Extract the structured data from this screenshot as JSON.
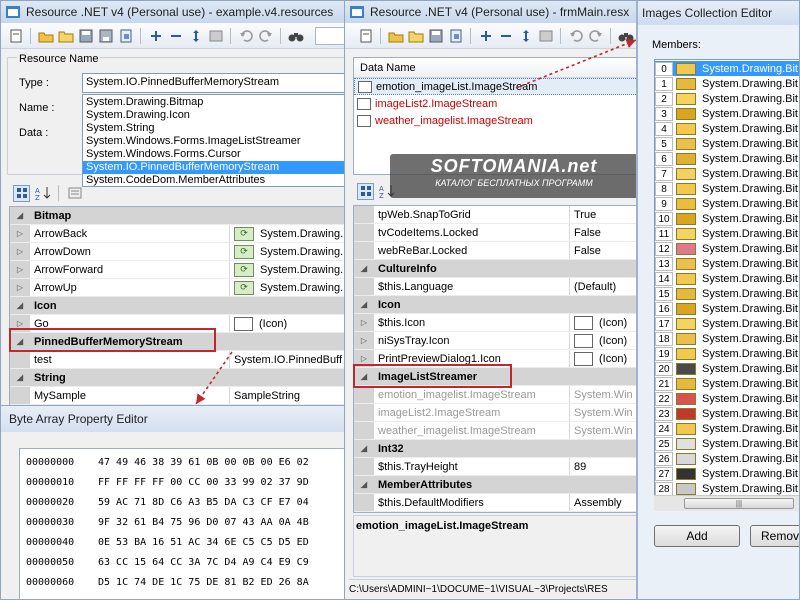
{
  "left_window": {
    "title": "Resource .NET v4 (Personal  use) - example.v4.resources",
    "resource_group_label": "Resource Name",
    "type_label": "Type :",
    "type_value": "System.IO.PinnedBufferMemoryStream",
    "name_label": "Name :",
    "data_label": "Data :",
    "type_options": [
      "System.Drawing.Bitmap",
      "System.Drawing.Icon",
      "System.String",
      "System.Windows.Forms.ImageListStreamer",
      "System.Windows.Forms.Cursor",
      "System.IO.PinnedBufferMemoryStream",
      "System.CodeDom.MemberAttributes"
    ],
    "selected_option": "System.IO.PinnedBufferMemoryStream",
    "grid": {
      "cat_bitmap": "Bitmap",
      "bitmap_rows": [
        {
          "name": "ArrowBack",
          "value": "System.Drawing."
        },
        {
          "name": "ArrowDown",
          "value": "System.Drawing."
        },
        {
          "name": "ArrowForward",
          "value": "System.Drawing."
        },
        {
          "name": "ArrowUp",
          "value": "System.Drawing."
        }
      ],
      "cat_icon": "Icon",
      "icon_row": {
        "name": "Go",
        "value": "(Icon)"
      },
      "cat_pinned": "PinnedBufferMemoryStream",
      "pinned_row": {
        "name": "test",
        "value": "System.IO.PinnedBuff"
      },
      "cat_string": "String",
      "string_row": {
        "name": "MySample",
        "value": "SampleString"
      }
    }
  },
  "byte_editor": {
    "title": "Byte Array Property Editor",
    "rows": [
      {
        "offset": "00000000",
        "bytes": "47  49  46  38  39  61  0B  00    0B  00  E6  02"
      },
      {
        "offset": "00000010",
        "bytes": "FF  FF  FF  FF  00  CC  00  33    99  02  37  9D"
      },
      {
        "offset": "00000020",
        "bytes": "59  AC  71  8D  C6  A3  B5  DA    C3  CF  E7  04"
      },
      {
        "offset": "00000030",
        "bytes": "9F  32  61  B4  75  96  D0  07    43  AA  0A  4B"
      },
      {
        "offset": "00000040",
        "bytes": "0E  53  BA  16  51  AC  34  6E    C5  C5  D5  ED"
      },
      {
        "offset": "00000050",
        "bytes": "63  CC  15  64  CC  3A  7C  D4    A9  C4  E9  C9"
      },
      {
        "offset": "00000060",
        "bytes": "D5  1C  74  DE  1C  75  DE  81    B2  ED  26  8A"
      }
    ]
  },
  "mid_window": {
    "title": "Resource .NET v4 (Personal  use) - frmMain.resx",
    "data_name_header": "Data Name",
    "data_items": [
      "emotion_imageList.ImageStream",
      "imageList2.ImageStream",
      "weather_imagelist.ImageStream"
    ],
    "watermark_title": "SOFTOMANIA.net",
    "watermark_sub": "КАТАЛОГ БЕСПЛАТНЫХ ПРОГРАММ",
    "grid": {
      "top_rows": [
        {
          "name": "tpWeb.SnapToGrid",
          "value": "True"
        },
        {
          "name": "tvCodeItems.Locked",
          "value": "False"
        },
        {
          "name": "webReBar.Locked",
          "value": "False"
        }
      ],
      "cat_culture": "CultureInfo",
      "culture_row": {
        "name": "$this.Language",
        "value": "(Default)"
      },
      "cat_icon": "Icon",
      "icon_rows": [
        {
          "name": "$this.Icon",
          "value": "(Icon)"
        },
        {
          "name": "niSysTray.Icon",
          "value": "(Icon)"
        },
        {
          "name": "PrintPreviewDialog1.Icon",
          "value": "(Icon)"
        }
      ],
      "cat_imagelist": "ImageListStreamer",
      "imagelist_rows": [
        {
          "name": "emotion_imagelist.ImageStream",
          "value": "System.Win"
        },
        {
          "name": "imageList2.ImageStream",
          "value": "System.Win"
        },
        {
          "name": "weather_imagelist.ImageStream",
          "value": "System.Win"
        }
      ],
      "cat_int32": "Int32",
      "int32_row": {
        "name": "$this.TrayHeight",
        "value": "89"
      },
      "cat_member": "MemberAttributes",
      "member_row": {
        "name": "$this.DefaultModifiers",
        "value": "Assembly"
      }
    },
    "description": "emotion_imageList.ImageStream",
    "status_path": "C:\\Users\\ADMINI~1\\DOCUME~1\\VISUAL~3\\Projects\\RES"
  },
  "images_editor": {
    "title": "Images Collection Editor",
    "members_label": "Members:",
    "item_label": "System.Drawing.Bit",
    "indices": [
      "0",
      "1",
      "2",
      "3",
      "4",
      "5",
      "6",
      "7",
      "8",
      "9",
      "10",
      "11",
      "12",
      "13",
      "14",
      "15",
      "16",
      "17",
      "18",
      "19",
      "20",
      "21",
      "22",
      "23",
      "24",
      "25",
      "26",
      "27",
      "28"
    ],
    "add_label": "Add",
    "remove_label": "Remov",
    "scroll_grip": "|||"
  },
  "colors": {
    "title_bar": "#dfe9f5",
    "selection": "#3399ff",
    "highlight_box": "#c1272d",
    "category_bg": "#d4d4d4",
    "red_text": "#cc0000"
  }
}
